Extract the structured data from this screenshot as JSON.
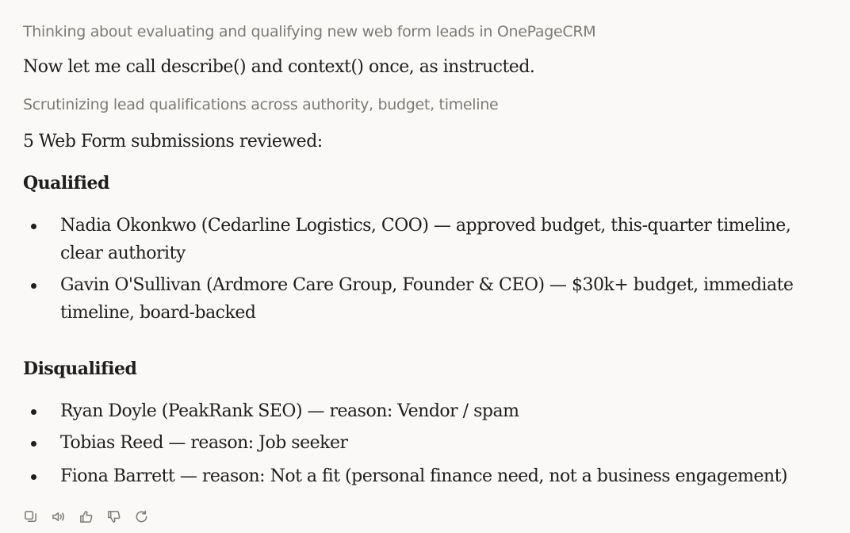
{
  "thinking_1": "Thinking about evaluating and qualifying new web form leads in OnePageCRM",
  "intro": "Now let me call describe() and context() once, as instructed.",
  "thinking_2": "Scrutinizing lead qualifications across authority, budget, timeline",
  "summary": "5 Web Form submissions reviewed:",
  "qualified": {
    "heading": "Qualified",
    "items": [
      "Nadia Okonkwo (Cedarline Logistics, COO) — approved budget, this-quarter timeline, clear authority",
      "Gavin O'Sullivan (Ardmore Care Group, Founder & CEO) — $30k+ budget, immediate timeline, board-backed"
    ]
  },
  "disqualified": {
    "heading": "Disqualified",
    "items": [
      "Ryan Doyle (PeakRank SEO) — reason: Vendor / spam",
      "Tobias Reed — reason: Job seeker",
      "Fiona Barrett — reason: Not a fit (personal finance need, not a business engagement)"
    ]
  },
  "actions": {
    "icons": [
      "copy-icon",
      "speaker-icon",
      "thumbs-up-icon",
      "thumbs-down-icon",
      "retry-icon"
    ]
  }
}
